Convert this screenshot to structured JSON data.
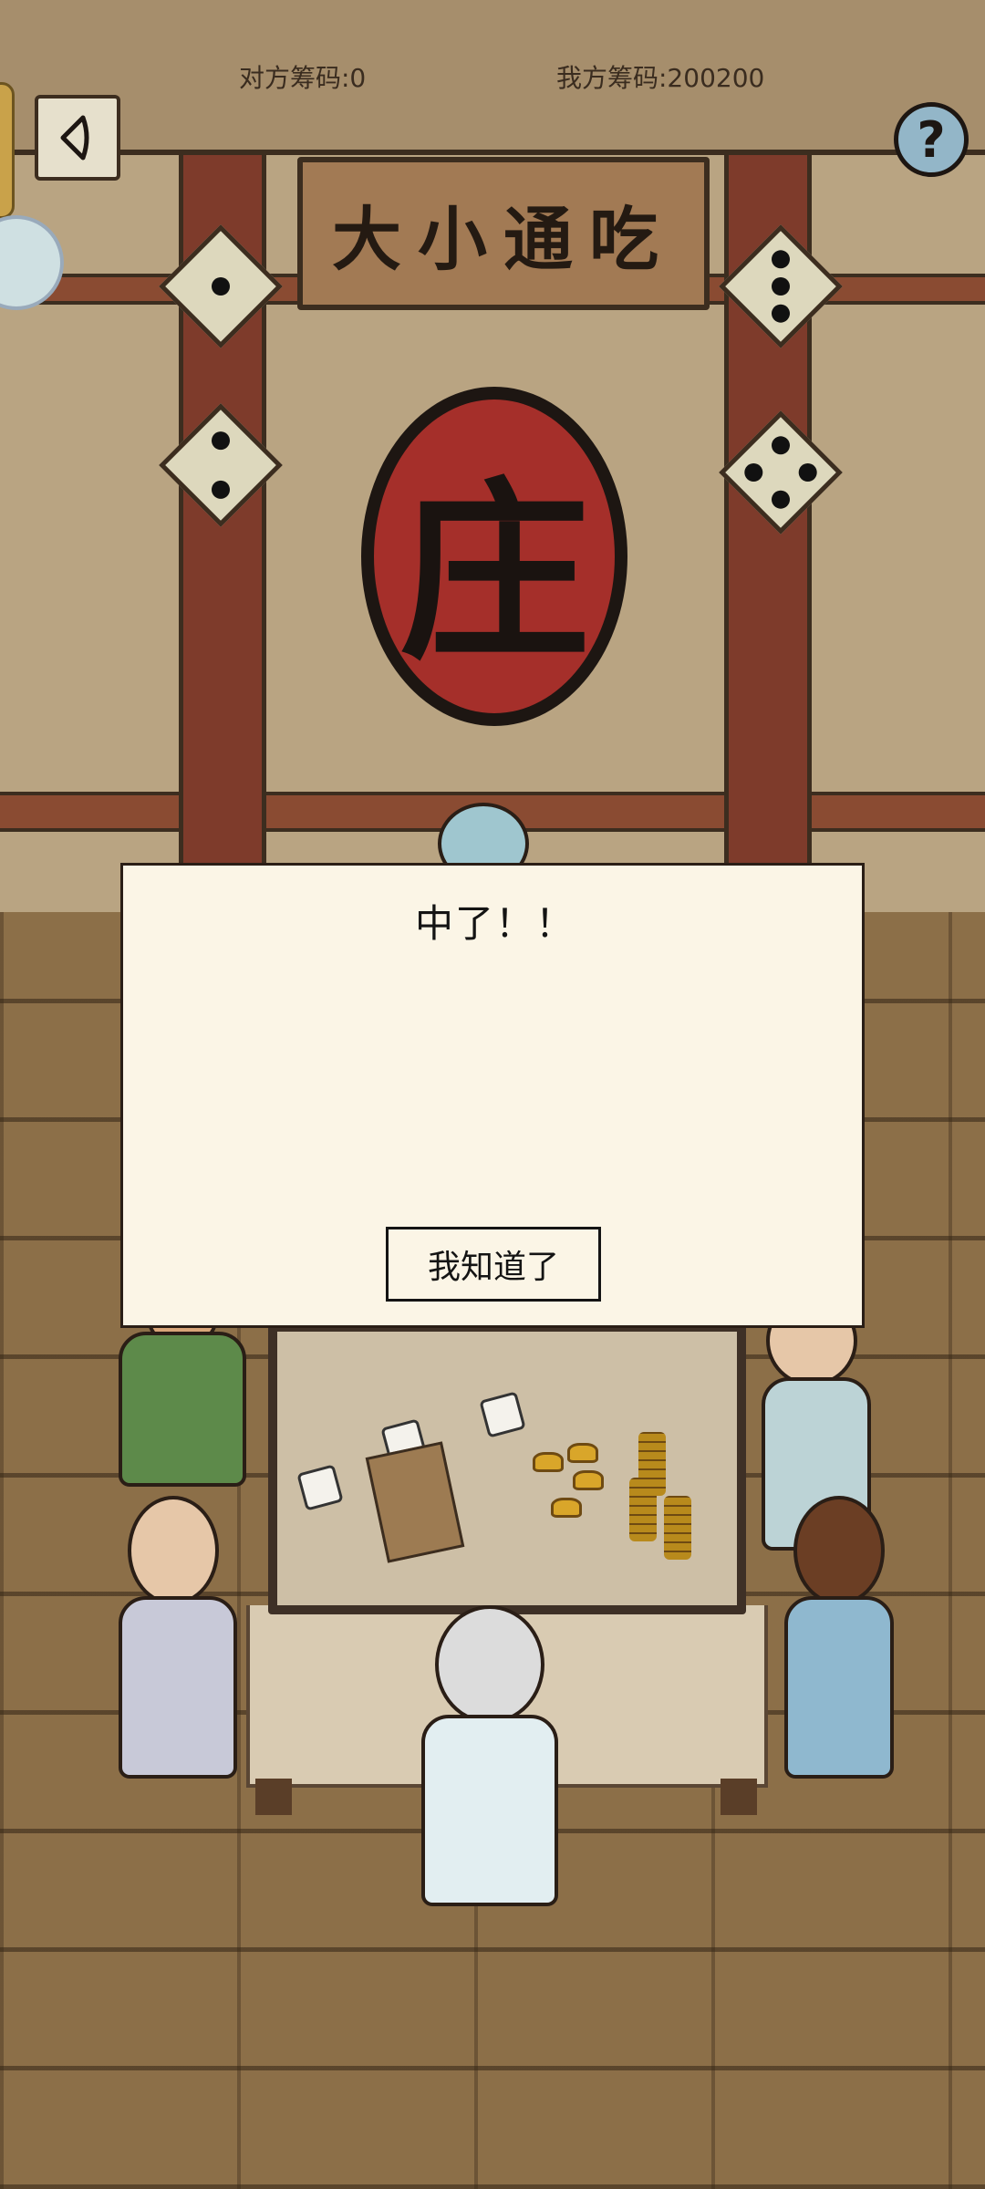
{
  "hud": {
    "opponent_chips": "对方筹码:0",
    "my_chips": "我方筹码:200200"
  },
  "scene": {
    "sign_text": "大小通吃",
    "emblem_text": "庄"
  },
  "dialog": {
    "title": "中了！！",
    "confirm_label": "我知道了"
  },
  "colors": {
    "wall": "#b9a482",
    "pillar": "#7e3b2b",
    "emblem_red": "#a52f2a",
    "dialog_bg": "#fbf5e6",
    "floor": "#8c6f48"
  },
  "icons": {
    "back": "chevron-left-icon",
    "help": "question-mark-icon"
  }
}
